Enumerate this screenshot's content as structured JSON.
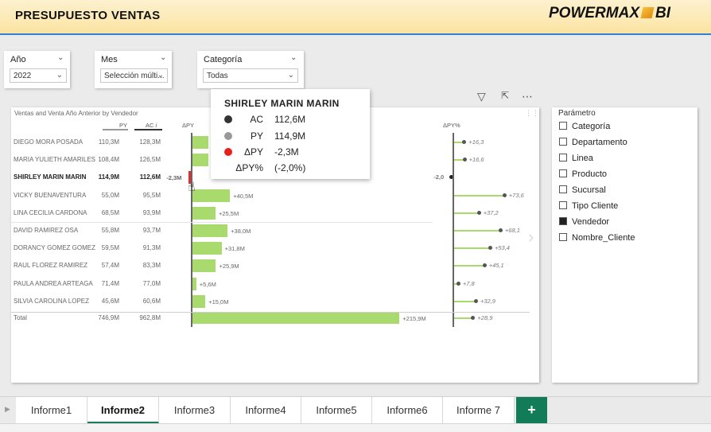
{
  "header": {
    "title": "PRESUPUESTO  VENTAS",
    "logo_text": "POWERMAX",
    "logo_suffix": "BI"
  },
  "slicers": [
    {
      "label": "Año",
      "value": "2022"
    },
    {
      "label": "Mes",
      "value": "Selección múlti..."
    },
    {
      "label": "Categoría",
      "value": "Todas"
    }
  ],
  "chart": {
    "title": "Ventas and Venta Año Anterior by Vendedor",
    "col_py": "PY",
    "col_ac": "AC",
    "col_ac_icon": "i",
    "col_dpy": "ΔPY",
    "col_dpct": "ΔPY%",
    "colors": {
      "positive": "#a8da6e",
      "negative": "#e0302e",
      "axis": "#666666"
    }
  },
  "chart_data": {
    "type": "table",
    "rows": [
      {
        "name": "DIEGO MORA POSADA",
        "py": "110,3M",
        "ac": "128,3M",
        "dpy": 18.0,
        "dpy_label": "",
        "dpct": 16.3,
        "dpct_label": "+16,3"
      },
      {
        "name": "MARIA YULIETH AMARILES",
        "py": "108,4M",
        "ac": "126,5M",
        "dpy": 18.1,
        "dpy_label": "",
        "dpct": 16.6,
        "dpct_label": "+16,6"
      },
      {
        "name": "SHIRLEY MARIN MARIN",
        "py": "114,9M",
        "ac": "112,6M",
        "dpy": -2.3,
        "dpy_label": "-2,3M",
        "dpct": -2.0,
        "dpct_label": "-2,0",
        "highlight": true
      },
      {
        "name": "VICKY BUENAVENTURA",
        "py": "55,0M",
        "ac": "95,5M",
        "dpy": 40.5,
        "dpy_label": "+40,5M",
        "dpct": 73.6,
        "dpct_label": "+73,6"
      },
      {
        "name": "LINA CECILIA CARDONA",
        "py": "68,5M",
        "ac": "93,9M",
        "dpy": 25.5,
        "dpy_label": "+25,5M",
        "dpct": 37.2,
        "dpct_label": "+37,2"
      },
      {
        "name": "DAVID RAMIREZ OSA",
        "py": "55,8M",
        "ac": "93,7M",
        "dpy": 38.0,
        "dpy_label": "+38,0M",
        "dpct": 68.1,
        "dpct_label": "+68,1"
      },
      {
        "name": "DORANCY GOMEZ GOMEZ",
        "py": "59,5M",
        "ac": "91,3M",
        "dpy": 31.8,
        "dpy_label": "+31,8M",
        "dpct": 53.4,
        "dpct_label": "+53,4"
      },
      {
        "name": "RAUL FLOREZ RAMIREZ",
        "py": "57,4M",
        "ac": "83,3M",
        "dpy": 25.9,
        "dpy_label": "+25,9M",
        "dpct": 45.1,
        "dpct_label": "+45,1"
      },
      {
        "name": "PAULA ANDREA ARTEAGA",
        "py": "71,4M",
        "ac": "77,0M",
        "dpy": 5.6,
        "dpy_label": "+5,6M",
        "dpct": 7.8,
        "dpct_label": "+7,8"
      },
      {
        "name": "SILVIA CAROLINA LOPEZ",
        "py": "45,6M",
        "ac": "60,6M",
        "dpy": 15.0,
        "dpy_label": "+15,0M",
        "dpct": 32.9,
        "dpct_label": "+32,9"
      }
    ],
    "total": {
      "name": "Total",
      "py": "746,9M",
      "ac": "962,8M",
      "dpy": 215.9,
      "dpy_label": "+215,9M",
      "dpct": 28.9,
      "dpct_label": "+28,9"
    }
  },
  "tooltip": {
    "title": "SHIRLEY MARIN MARIN",
    "items": [
      {
        "key": "AC",
        "value": "112,6M",
        "color": "#333333"
      },
      {
        "key": "PY",
        "value": "114,9M",
        "color": "#999999"
      },
      {
        "key": "ΔPY",
        "value": "-2,3M",
        "color": "#e8201a"
      },
      {
        "key": "ΔPY%",
        "value": "(-2,0%)",
        "color": ""
      }
    ]
  },
  "toolbar": {
    "filter_icon": "filter-icon",
    "focus_icon": "focus-mode-icon",
    "more_icon": "more-options-icon"
  },
  "parameter": {
    "title": "Parámetro",
    "items": [
      {
        "label": "Categoría",
        "checked": false
      },
      {
        "label": "Departamento",
        "checked": false
      },
      {
        "label": "Linea",
        "checked": false
      },
      {
        "label": "Producto",
        "checked": false
      },
      {
        "label": "Sucursal",
        "checked": false
      },
      {
        "label": "Tipo Cliente",
        "checked": false
      },
      {
        "label": "Vendedor",
        "checked": true
      },
      {
        "label": "Nombre_Cliente",
        "checked": false
      }
    ]
  },
  "tabs": [
    "Informe1",
    "Informe2",
    "Informe3",
    "Informe4",
    "Informe5",
    "Informe6",
    "Informe 7"
  ],
  "active_tab": 1,
  "add_tab_label": "+"
}
